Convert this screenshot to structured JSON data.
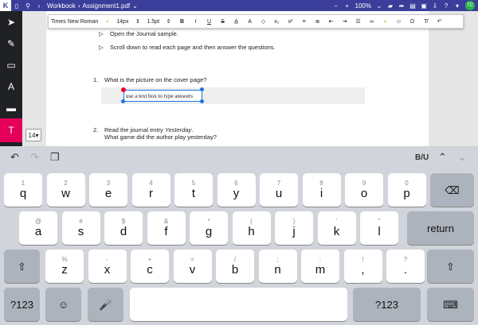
{
  "topbar": {
    "app_logo": "K",
    "crumb1": "Workbook",
    "crumb2": "Assignment1.pdf",
    "zoom": "100%",
    "user_initials": "TC",
    "icons": [
      "sidebar-icon",
      "search-icon",
      "chevron-right-icon",
      "chevron-down-icon",
      "minus-icon",
      "plus-icon",
      "chevron-down-icon",
      "folder-icon",
      "share-icon",
      "print-icon",
      "save-icon",
      "upload-icon",
      "help-icon",
      "dropdown-icon",
      "avatar"
    ]
  },
  "format_toolbar": {
    "font": "Times New Roman",
    "size": "14px",
    "stroke": "1.5pt"
  },
  "sidebar": {
    "tools": [
      "select",
      "annotate",
      "lock",
      "text-stamp",
      "comment",
      "text"
    ],
    "size_value": "14"
  },
  "document": {
    "line1": "Open the Journal sample.",
    "line2": "Scroll down to read each page and then answer the questions.",
    "q1_num": "1.",
    "q1_text": "What is the picture on the cover page?",
    "textbox_value": "use a text box to type answers",
    "q2_num": "2.",
    "q2_line1_prefix": "Read the journal entry ",
    "q2_line1_em": "Yesterday",
    "q2_line1_suffix": ".",
    "q2_line2": "What game did the author play yesterday?"
  },
  "keyboard": {
    "format_label": "B/U",
    "row1": [
      {
        "num": "1",
        "ch": "q"
      },
      {
        "num": "2",
        "ch": "w"
      },
      {
        "num": "3",
        "ch": "e"
      },
      {
        "num": "4",
        "ch": "r"
      },
      {
        "num": "5",
        "ch": "t"
      },
      {
        "num": "6",
        "ch": "y"
      },
      {
        "num": "7",
        "ch": "u"
      },
      {
        "num": "8",
        "ch": "i"
      },
      {
        "num": "9",
        "ch": "o"
      },
      {
        "num": "0",
        "ch": "p"
      }
    ],
    "row2": [
      {
        "num": "@",
        "ch": "a"
      },
      {
        "num": "#",
        "ch": "s"
      },
      {
        "num": "$",
        "ch": "d"
      },
      {
        "num": "&",
        "ch": "f"
      },
      {
        "num": "*",
        "ch": "g"
      },
      {
        "num": "(",
        "ch": "h"
      },
      {
        "num": ")",
        "ch": "j"
      },
      {
        "num": "'",
        "ch": "k"
      },
      {
        "num": "\"",
        "ch": "l"
      }
    ],
    "row3": [
      {
        "num": "%",
        "ch": "z"
      },
      {
        "num": "-",
        "ch": "x"
      },
      {
        "num": "+",
        "ch": "c"
      },
      {
        "num": "=",
        "ch": "v"
      },
      {
        "num": "/",
        "ch": "b"
      },
      {
        "num": ";",
        "ch": "n"
      },
      {
        "num": ":",
        "ch": "m"
      },
      {
        "num": "!",
        "ch": ","
      },
      {
        "num": "?",
        "ch": "."
      }
    ],
    "return_label": "return",
    "num_label": "?123"
  }
}
